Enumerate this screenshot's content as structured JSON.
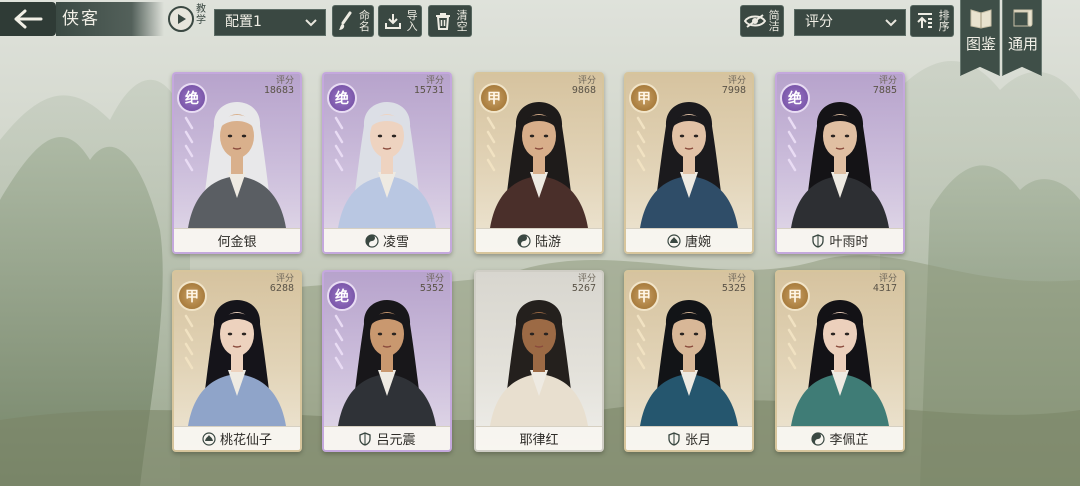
{
  "header": {
    "title": "侠客",
    "teach_label": "教学",
    "config_value": "配置1",
    "rename_label": "命名",
    "import_label": "导入",
    "clear_label": "清空",
    "simple_label": "简洁",
    "sort_value": "评分",
    "order_label": "排序"
  },
  "side_tabs": [
    {
      "label": "图鉴"
    },
    {
      "label": "通用"
    }
  ],
  "card_score_label": "评分",
  "colors": {
    "jue_purple": "#9a77c6",
    "jia_gold": "#c9a064",
    "toolbar_dark": "#3a4842"
  },
  "heroes": [
    {
      "name": "何金银",
      "score": "18683",
      "grade": "绝",
      "faction_icon": "none"
    },
    {
      "name": "凌雪",
      "score": "15731",
      "grade": "绝",
      "faction_icon": "yin-yang-icon"
    },
    {
      "name": "陆游",
      "score": "9868",
      "grade": "甲",
      "faction_icon": "yin-yang-icon"
    },
    {
      "name": "唐婉",
      "score": "7998",
      "grade": "甲",
      "faction_icon": "lotus-icon"
    },
    {
      "name": "叶雨时",
      "score": "7885",
      "grade": "绝",
      "faction_icon": "shield-icon"
    },
    {
      "name": "桃花仙子",
      "score": "6288",
      "grade": "甲",
      "faction_icon": "lotus-icon"
    },
    {
      "name": "吕元震",
      "score": "5352",
      "grade": "绝",
      "faction_icon": "shield-icon"
    },
    {
      "name": "耶律红",
      "score": "5267",
      "grade": "",
      "faction_icon": "none"
    },
    {
      "name": "张月",
      "score": "5325",
      "grade": "甲",
      "faction_icon": "shield-icon"
    },
    {
      "name": "李佩芷",
      "score": "4317",
      "grade": "甲",
      "faction_icon": "yin-yang-icon"
    }
  ]
}
